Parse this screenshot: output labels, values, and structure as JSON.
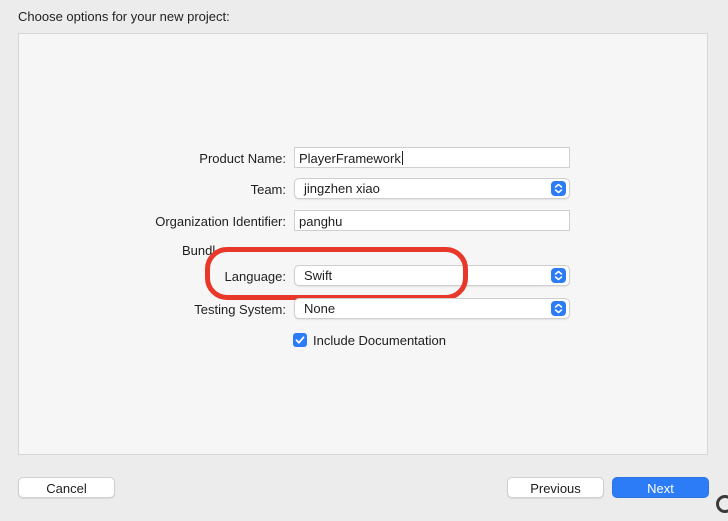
{
  "sheet": {
    "title": "Choose options for your new project:"
  },
  "form": {
    "product_name": {
      "label": "Product Name:",
      "value": "PlayerFramework"
    },
    "team": {
      "label": "Team:",
      "value": "jingzhen xiao"
    },
    "organization_identifier": {
      "label": "Organization Identifier:",
      "value": "panghu"
    },
    "bundle_identifier": {
      "label_visible": "Bundl",
      "value_visible": ""
    },
    "language": {
      "label": "Language:",
      "value": "Swift"
    },
    "testing_system": {
      "label": "Testing System:",
      "value": "None"
    },
    "include_documentation": {
      "label": "Include Documentation",
      "checked": true
    }
  },
  "footer": {
    "cancel_label": "Cancel",
    "previous_label": "Previous",
    "next_label": "Next"
  },
  "annotation": {
    "color": "#e8382a",
    "target": "language"
  },
  "colors": {
    "accent": "#2b7cf6",
    "panel_bg": "#f6f6f6",
    "window_bg": "#ececec"
  },
  "icons": [
    "chevron-up-down-icon",
    "checkmark-icon"
  ]
}
